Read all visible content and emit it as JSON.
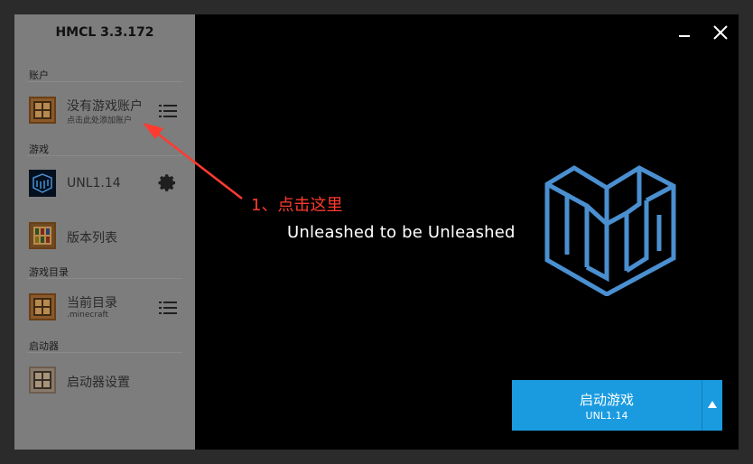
{
  "app": {
    "title": "HMCL 3.3.172"
  },
  "sidebar": {
    "sections": [
      {
        "label": "账户"
      },
      {
        "label": "游戏"
      },
      {
        "label": "游戏目录"
      },
      {
        "label": "启动器"
      }
    ],
    "account": {
      "title": "没有游戏账户",
      "subtitle": "点击此处添加账户",
      "icon": "crafting-table-icon",
      "action_icon": "list-icon"
    },
    "game": {
      "title": "UNL1.14",
      "icon": "game-logo-icon",
      "action_icon": "gear-icon"
    },
    "version_list": {
      "title": "版本列表",
      "icon": "bookshelf-icon"
    },
    "directory": {
      "title": "当前目录",
      "subtitle": ".minecraft",
      "icon": "crafting-table-icon",
      "action_icon": "list-icon"
    },
    "launcher_settings": {
      "title": "启动器设置",
      "icon": "crafting-table-icon"
    }
  },
  "main": {
    "tagline": "Unleashed to be Unleashed",
    "annotation": "1、点击这里",
    "logo_icon": "unl-cube-logo-icon",
    "launch": {
      "label": "启动游戏",
      "version": "UNL1.14"
    }
  },
  "window_controls": {
    "minimize": "minimize-icon",
    "close": "close-icon"
  },
  "colors": {
    "sidebar_bg": "#7d7d7d",
    "main_bg": "#000000",
    "accent": "#1a9be0",
    "logo": "#4a8fd0",
    "annotation": "#ff3b30"
  }
}
